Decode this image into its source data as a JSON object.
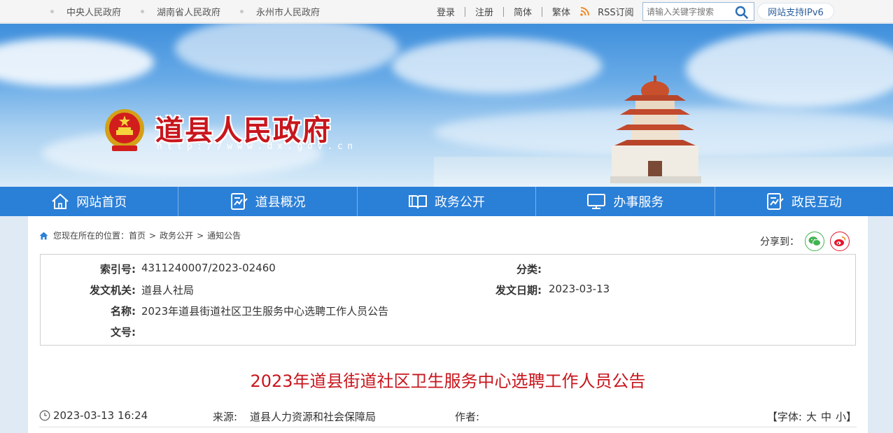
{
  "topbar": {
    "links": [
      "中央人民政府",
      "湖南省人民政府",
      "永州市人民政府"
    ],
    "login": "登录",
    "register": "注册",
    "simplified": "简体",
    "traditional": "繁体",
    "rss": "RSS订阅",
    "search_placeholder": "请输入关键字搜索",
    "ipv6": "网站支持IPv6"
  },
  "header": {
    "site_name": "道县人民政府",
    "site_url": "http://www.dx.gov.cn"
  },
  "nav": {
    "items": [
      {
        "label": "网站首页",
        "icon": "home-icon"
      },
      {
        "label": "道县概况",
        "icon": "document-chart-icon"
      },
      {
        "label": "政务公开",
        "icon": "open-book-icon"
      },
      {
        "label": "办事服务",
        "icon": "monitor-icon"
      },
      {
        "label": "政民互动",
        "icon": "document-chart-icon"
      }
    ]
  },
  "breadcrumb": {
    "prefix": "您现在所在的位置：",
    "items": [
      "首页",
      "政务公开",
      "通知公告"
    ],
    "separator": ">"
  },
  "share": {
    "label": "分享到：",
    "wechat_color": "#3fb34f",
    "weibo_color": "#e6162d"
  },
  "meta": {
    "index_label": "索引号:",
    "index_value": "4311240007/2023-02460",
    "category_label": "分类:",
    "category_value": "",
    "issuer_label": "发文机关:",
    "issuer_value": "道县人社局",
    "date_label": "发文日期:",
    "date_value": "2023-03-13",
    "name_label": "名称:",
    "name_value": "2023年道县街道社区卫生服务中心选聘工作人员公告",
    "docno_label": "文号:",
    "docno_value": ""
  },
  "article": {
    "title": "2023年道县街道社区卫生服务中心选聘工作人员公告",
    "time": "2023-03-13 16:24",
    "source_label": "来源:",
    "source_value": "道县人力资源和社会保障局",
    "author_label": "作者:",
    "font_label": "【字体:",
    "font_large": "大",
    "font_medium": "中",
    "font_small": "小",
    "font_close": "】"
  },
  "colors": {
    "nav_bg": "#2a7fd7",
    "title_red": "#c8161d",
    "rss_orange": "#f08a24"
  }
}
